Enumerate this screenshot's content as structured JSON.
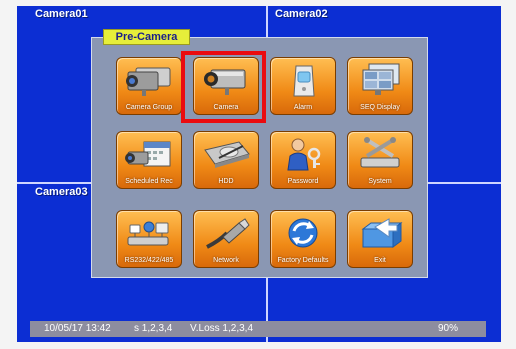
{
  "cameras": {
    "cam1": "Camera01",
    "cam2": "Camera02",
    "cam3": "Camera03"
  },
  "menu": {
    "title": "Pre-Camera",
    "items": [
      {
        "label": "Camera Group",
        "icon": "camera-group-icon",
        "selected": false
      },
      {
        "label": "Camera",
        "icon": "camera-icon",
        "selected": true
      },
      {
        "label": "Alarm",
        "icon": "alarm-sensor-icon",
        "selected": false
      },
      {
        "label": "SEQ Display",
        "icon": "seq-display-icon",
        "selected": false
      },
      {
        "label": "Scheduled Rec",
        "icon": "scheduled-rec-icon",
        "selected": false
      },
      {
        "label": "HDD",
        "icon": "hdd-icon",
        "selected": false
      },
      {
        "label": "Password",
        "icon": "password-user-icon",
        "selected": false
      },
      {
        "label": "System",
        "icon": "system-tools-icon",
        "selected": false
      },
      {
        "label": "RS232/422/485",
        "icon": "rs232-devices-icon",
        "selected": false
      },
      {
        "label": "Network",
        "icon": "network-cable-icon",
        "selected": false
      },
      {
        "label": "Factory Defaults",
        "icon": "factory-defaults-icon",
        "selected": false
      },
      {
        "label": "Exit",
        "icon": "exit-icon",
        "selected": false
      }
    ]
  },
  "status": {
    "datetime": "10/05/17 13:42",
    "s": "s 1,2,3,4",
    "vloss": "V.Loss 1,2,3,4",
    "percent": "90%"
  },
  "colors": {
    "screen": "#0c2ed3",
    "tile": "#f08a16",
    "highlight": "#ea0b10",
    "title_bg": "#e6ee3a"
  }
}
